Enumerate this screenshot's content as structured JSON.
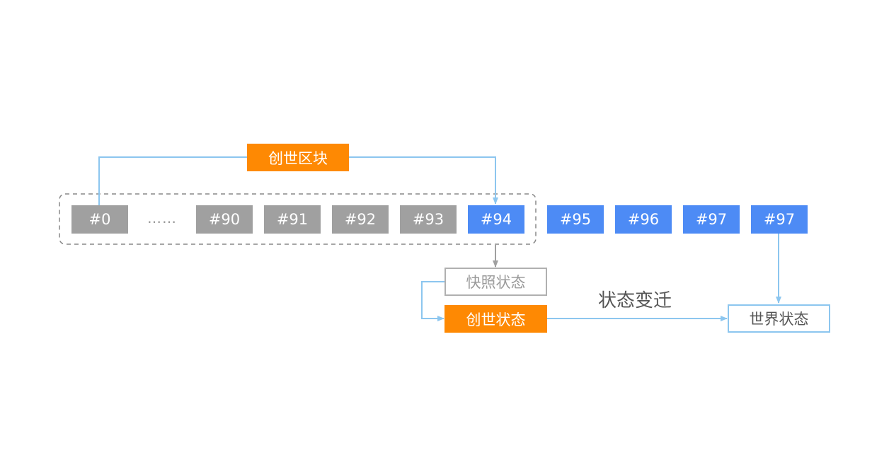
{
  "blocks": {
    "b0": "#0",
    "ellipsis": "……",
    "b90": "#90",
    "b91": "#91",
    "b92": "#92",
    "b93": "#93",
    "b94": "#94",
    "b95": "#95",
    "b96": "#96",
    "b97a": "#97",
    "b97b": "#97"
  },
  "labels": {
    "genesis_block": "创世区块",
    "snapshot_state": "快照状态",
    "genesis_state": "创世状态",
    "world_state": "世界状态",
    "state_transition": "状态变迁"
  },
  "colors": {
    "gray_block": "#a0a0a0",
    "blue_block": "#4d8bf5",
    "orange": "#fe8903",
    "arrow_blue": "#8cc6ef",
    "arrow_gray": "#a0a0a0",
    "dashed_border": "#888888"
  }
}
